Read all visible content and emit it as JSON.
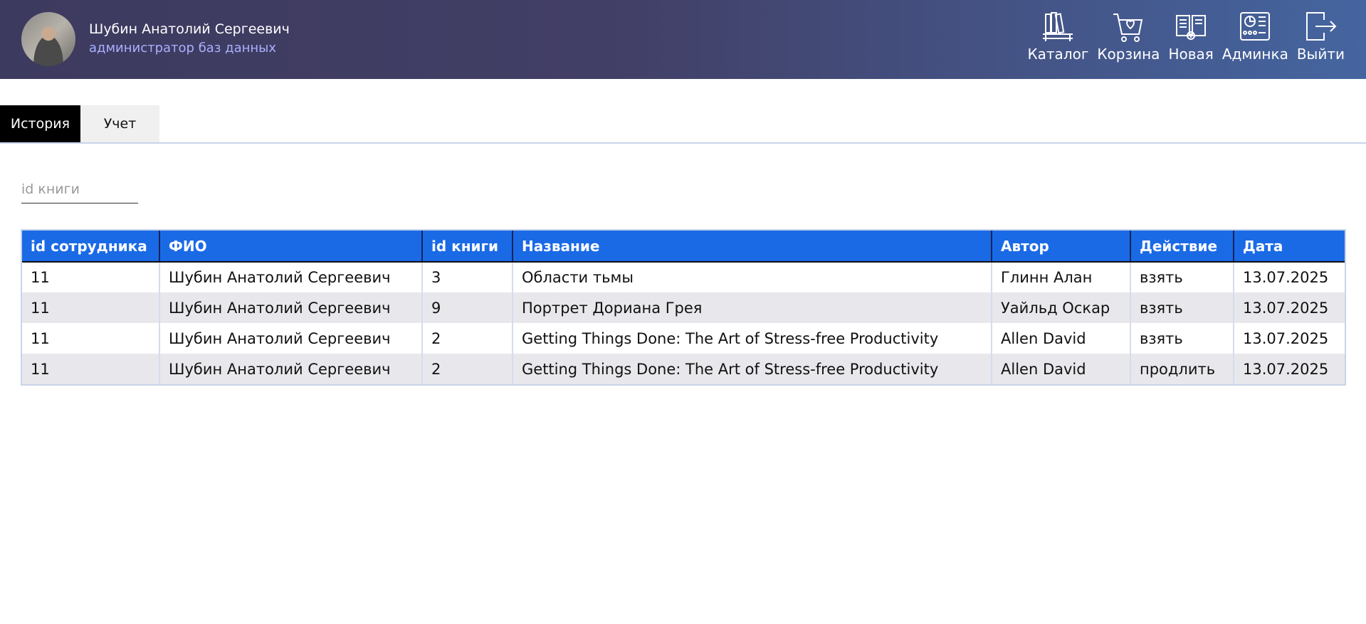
{
  "user": {
    "name": "Шубин Анатолий Сергеевич",
    "role": "администратор баз данных"
  },
  "nav": [
    {
      "label": "Каталог",
      "icon": "bookshelf-icon"
    },
    {
      "label": "Корзина",
      "icon": "cart-heart-icon"
    },
    {
      "label": "Новая",
      "icon": "new-book-icon"
    },
    {
      "label": "Админка",
      "icon": "dashboard-icon"
    },
    {
      "label": "Выйти",
      "icon": "logout-icon"
    }
  ],
  "tabs": {
    "history": "История",
    "accounting": "Учет",
    "active": "История"
  },
  "search": {
    "placeholder": "id книги",
    "value": ""
  },
  "table": {
    "headers": [
      "id сотрудника",
      "ФИО",
      "id книги",
      "Название",
      "Автор",
      "Действие",
      "Дата"
    ],
    "rows": [
      [
        "11",
        "Шубин Анатолий Сергеевич",
        "3",
        "Области тьмы",
        "Глинн Алан",
        "взять",
        "13.07.2025"
      ],
      [
        "11",
        "Шубин Анатолий Сергеевич",
        "9",
        "Портрет Дориана Грея",
        "Уайльд Оскар",
        "взять",
        "13.07.2025"
      ],
      [
        "11",
        "Шубин Анатолий Сергеевич",
        "2",
        "Getting Things Done: The Art of Stress-free Productivity",
        "Allen David",
        "взять",
        "13.07.2025"
      ],
      [
        "11",
        "Шубин Анатолий Сергеевич",
        "2",
        "Getting Things Done: The Art of Stress-free Productivity",
        "Allen David",
        "продлить",
        "13.07.2025"
      ]
    ]
  },
  "colors": {
    "header_start": "#3d3a5f",
    "header_end": "#4565a0",
    "table_header": "#1a6ae6",
    "active_tab": "#000000",
    "role_text": "#a9b0ff"
  }
}
